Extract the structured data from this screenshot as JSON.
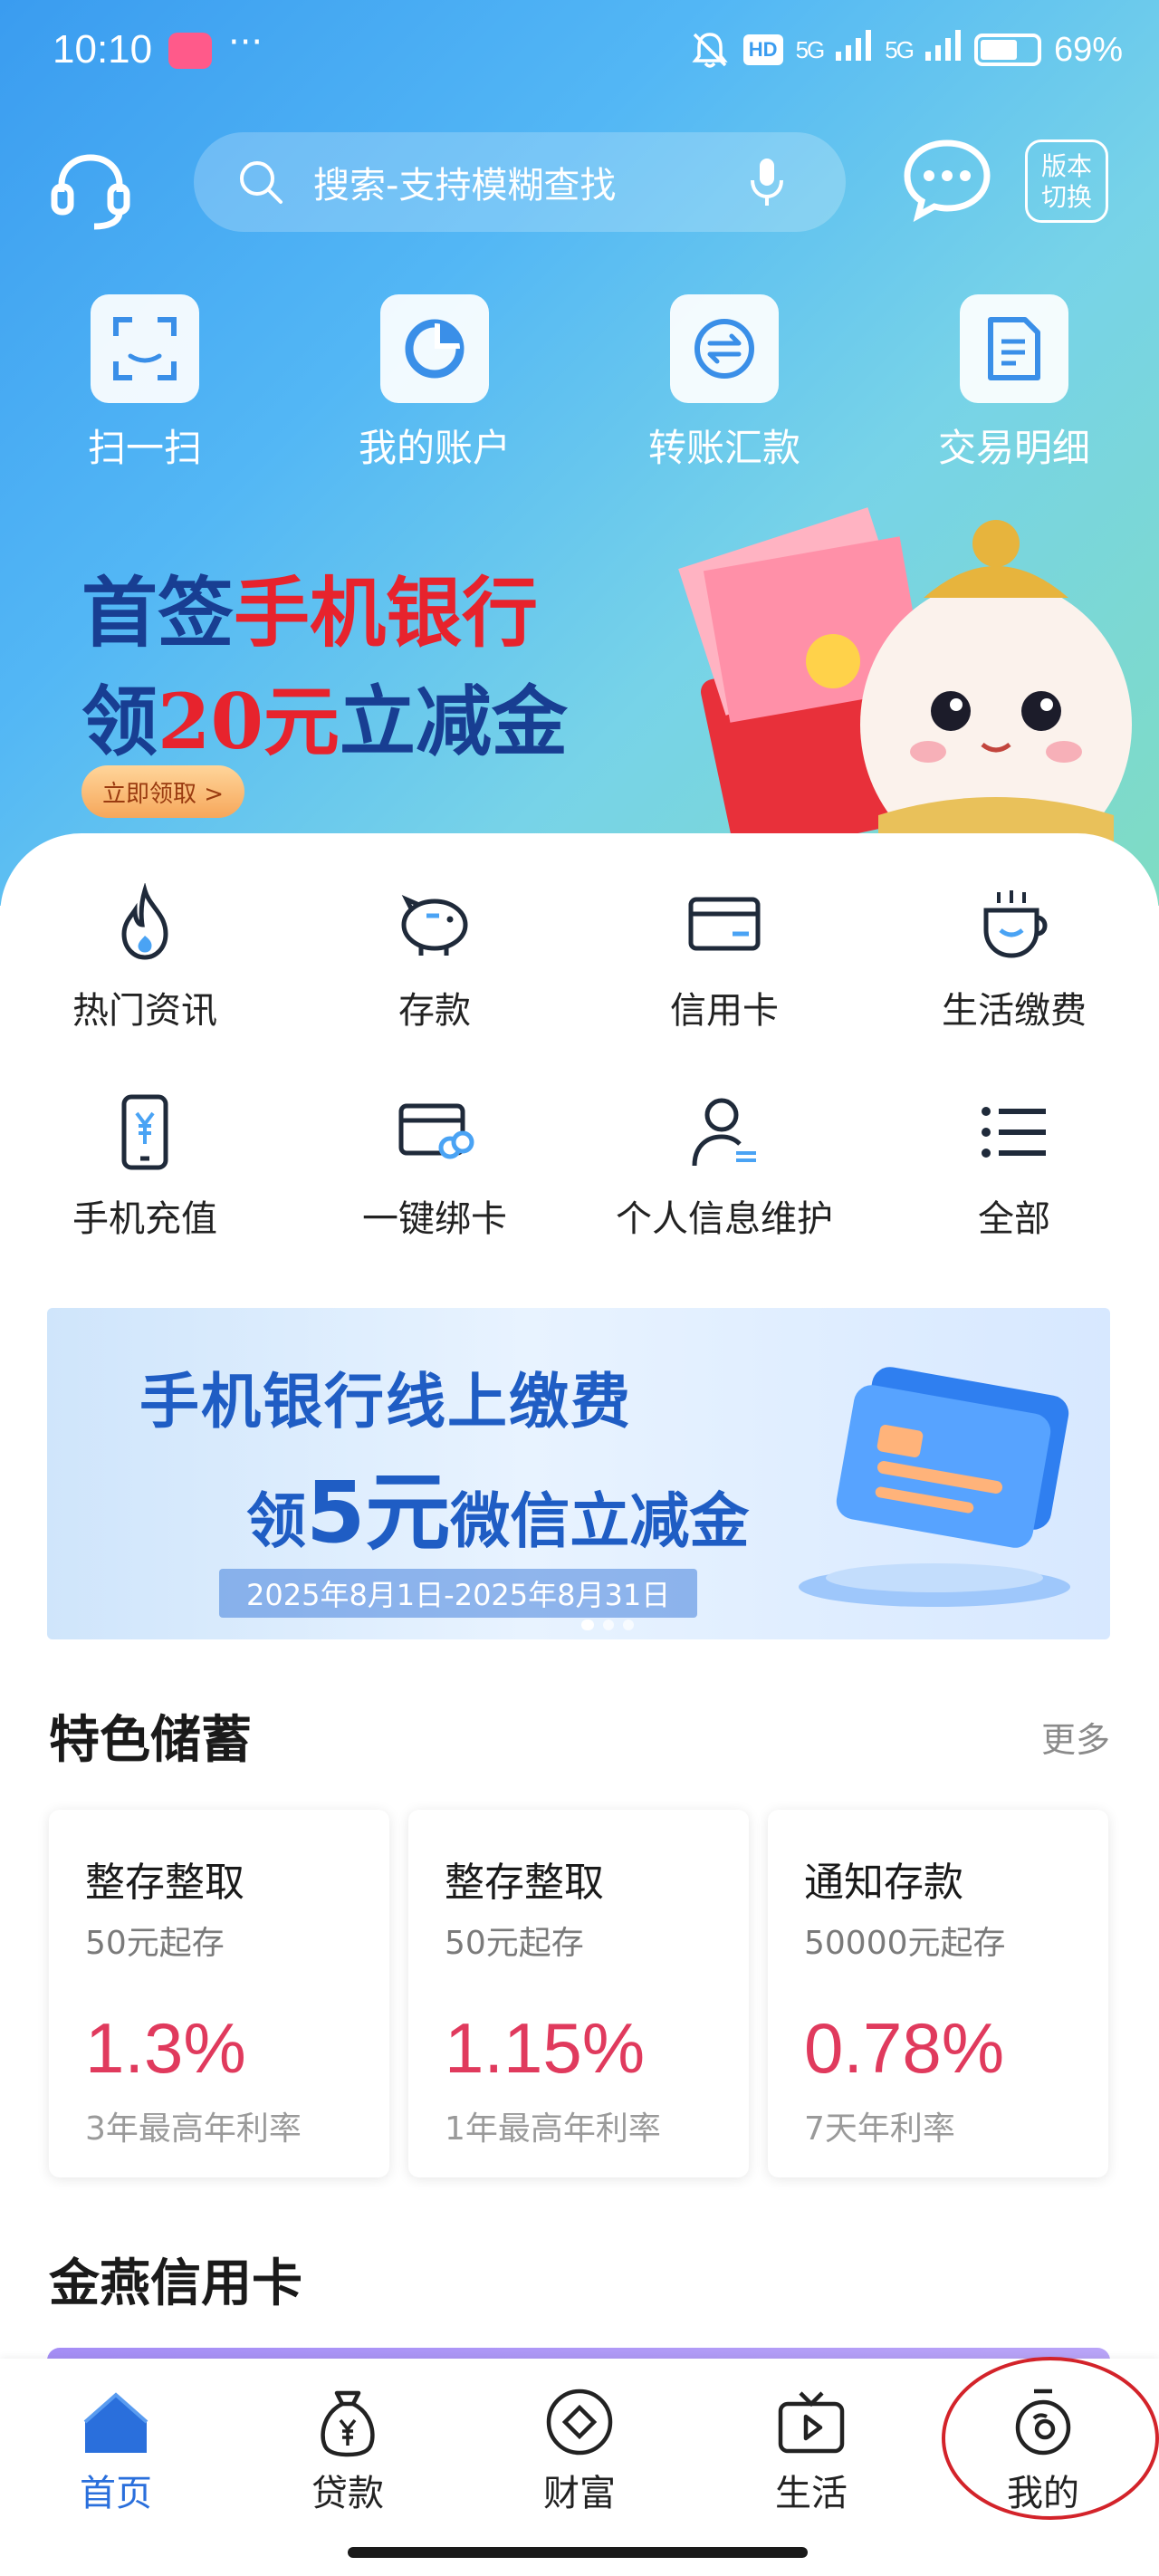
{
  "status_bar": {
    "time": "10:10",
    "more": "···",
    "hd": "HD",
    "signal1": "5G",
    "signal2": "5G",
    "battery": "69%"
  },
  "topbar": {
    "search_placeholder": "搜索-支持模糊查找",
    "version_switch": "版本切换"
  },
  "quick_actions": [
    {
      "label": "扫一扫",
      "icon": "scan-icon"
    },
    {
      "label": "我的账户",
      "icon": "account-pie-icon"
    },
    {
      "label": "转账汇款",
      "icon": "transfer-icon"
    },
    {
      "label": "交易明细",
      "icon": "document-icon"
    }
  ],
  "promo": {
    "line1_a": "首签",
    "line1_b": "手机银行",
    "line2_a": "领",
    "line2_b": "20元",
    "line2_c": "立减金",
    "button": "立即领取 >"
  },
  "service_grid": [
    {
      "label": "热门资讯",
      "icon": "fire-icon"
    },
    {
      "label": "存款",
      "icon": "piggy-bank-icon"
    },
    {
      "label": "信用卡",
      "icon": "credit-card-icon"
    },
    {
      "label": "生活缴费",
      "icon": "coffee-cup-icon"
    },
    {
      "label": "手机充值",
      "icon": "phone-yuan-icon"
    },
    {
      "label": "一键绑卡",
      "icon": "bind-card-icon"
    },
    {
      "label": "个人信息维护",
      "icon": "person-icon"
    },
    {
      "label": "全部",
      "icon": "list-icon"
    }
  ],
  "banner2": {
    "line1": "手机银行线上缴费",
    "line2_a": "领",
    "line2_b": "5元",
    "line2_c": "微信立减金",
    "date": "2025年8月1日-2025年8月31日"
  },
  "savings": {
    "title": "特色储蓄",
    "more": "更多",
    "cards": [
      {
        "name": "整存整取",
        "min": "50元起存",
        "rate": "1.3%",
        "desc": "3年最高年利率"
      },
      {
        "name": "整存整取",
        "min": "50元起存",
        "rate": "1.15%",
        "desc": "1年最高年利率"
      },
      {
        "name": "通知存款",
        "min": "50000元起存",
        "rate": "0.78%",
        "desc": "7天年利率"
      }
    ]
  },
  "credit": {
    "title": "金燕信用卡"
  },
  "bottom_nav": [
    {
      "label": "首页",
      "icon": "home-icon",
      "active": true
    },
    {
      "label": "贷款",
      "icon": "money-bag-icon"
    },
    {
      "label": "财富",
      "icon": "diamond-coin-icon"
    },
    {
      "label": "生活",
      "icon": "tv-play-icon"
    },
    {
      "label": "我的",
      "icon": "profile-icon"
    }
  ],
  "colors": {
    "primary": "#2a6fdc",
    "rate_red": "#e03a5d",
    "promo_blue": "#183e92",
    "promo_red": "#e7232d",
    "annotation": "#d3232a"
  }
}
